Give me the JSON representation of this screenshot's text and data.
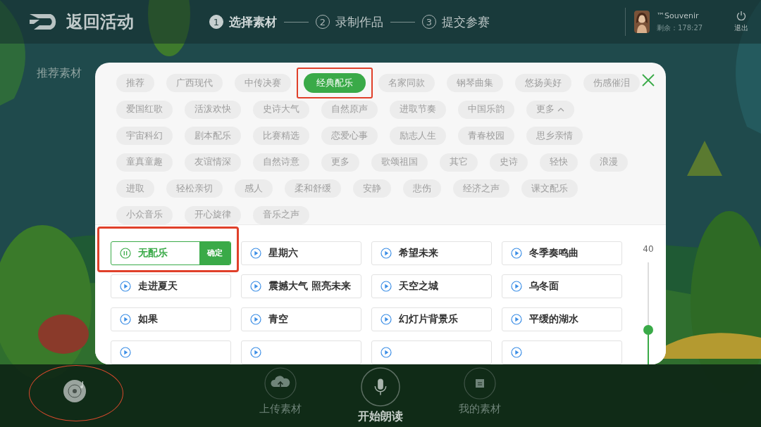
{
  "header": {
    "back_label": "返回活动",
    "steps": [
      {
        "number": "1",
        "label": "选择素材",
        "selected": true
      },
      {
        "number": "2",
        "label": "录制作品",
        "selected": false
      },
      {
        "number": "3",
        "label": "提交参赛",
        "selected": false
      }
    ],
    "user": {
      "name": "™Souvenir",
      "remaining": "剩余：178:27"
    },
    "logout": "退出"
  },
  "section_label": "推荐素材",
  "modal": {
    "tag_rows": [
      [
        {
          "label": "推荐",
          "selected": false
        },
        {
          "label": "广西现代",
          "selected": false
        },
        {
          "label": "中传决赛",
          "selected": false
        },
        {
          "label": "经典配乐",
          "selected": true
        },
        {
          "label": "名家同款",
          "selected": false
        },
        {
          "label": "钢琴曲集",
          "selected": false
        },
        {
          "label": "悠扬美好",
          "selected": false
        },
        {
          "label": "伤感催泪",
          "selected": false
        }
      ],
      [
        {
          "label": "爱国红歌",
          "selected": false
        },
        {
          "label": "活泼欢快",
          "selected": false
        },
        {
          "label": "史诗大气",
          "selected": false
        },
        {
          "label": "自然原声",
          "selected": false
        },
        {
          "label": "进取节奏",
          "selected": false
        },
        {
          "label": "中国乐韵",
          "selected": false
        },
        {
          "label": "更多",
          "selected": false,
          "kind": "more",
          "expanded": true
        }
      ],
      [
        {
          "label": "宇宙科幻",
          "selected": false
        },
        {
          "label": "剧本配乐",
          "selected": false
        },
        {
          "label": "比赛精选",
          "selected": false
        },
        {
          "label": "恋爱心事",
          "selected": false
        },
        {
          "label": "励志人生",
          "selected": false
        },
        {
          "label": "青春校园",
          "selected": false
        },
        {
          "label": "思乡亲情",
          "selected": false
        }
      ],
      [
        {
          "label": "童真童趣",
          "selected": false
        },
        {
          "label": "友谊情深",
          "selected": false
        },
        {
          "label": "自然诗意",
          "selected": false
        },
        {
          "label": "更多",
          "selected": false
        },
        {
          "label": "歌颂祖国",
          "selected": false
        },
        {
          "label": "其它",
          "selected": false
        },
        {
          "label": "史诗",
          "selected": false
        },
        {
          "label": "轻快",
          "selected": false
        },
        {
          "label": "浪漫",
          "selected": false
        }
      ],
      [
        {
          "label": "进取",
          "selected": false
        },
        {
          "label": "轻松亲切",
          "selected": false
        },
        {
          "label": "感人",
          "selected": false
        },
        {
          "label": "柔和舒缓",
          "selected": false
        },
        {
          "label": "安静",
          "selected": false
        },
        {
          "label": "悲伤",
          "selected": false
        },
        {
          "label": "经济之声",
          "selected": false
        },
        {
          "label": "课文配乐",
          "selected": false
        }
      ],
      [
        {
          "label": "小众音乐",
          "selected": false
        },
        {
          "label": "开心旋律",
          "selected": false
        },
        {
          "label": "音乐之声",
          "selected": false
        }
      ]
    ],
    "tracks": [
      {
        "title": "无配乐",
        "selected": true,
        "confirm": "确定"
      },
      {
        "title": "星期六",
        "selected": false
      },
      {
        "title": "希望未来",
        "selected": false
      },
      {
        "title": "冬季奏鸣曲",
        "selected": false
      },
      {
        "title": "走进夏天",
        "selected": false
      },
      {
        "title": "震撼大气 照亮未来",
        "selected": false
      },
      {
        "title": "天空之城",
        "selected": false
      },
      {
        "title": "乌冬面",
        "selected": false
      },
      {
        "title": "如果",
        "selected": false
      },
      {
        "title": "青空",
        "selected": false
      },
      {
        "title": "幻灯片背景乐",
        "selected": false
      },
      {
        "title": "平缓的湖水",
        "selected": false
      },
      {
        "kind": "clipped",
        "selected": false
      },
      {
        "kind": "clipped",
        "selected": false
      },
      {
        "kind": "clipped",
        "selected": false
      },
      {
        "kind": "clipped",
        "selected": false
      }
    ],
    "volume": {
      "reading": "40",
      "level": 0.4
    }
  },
  "bottom_nav": [
    {
      "kind": "disc",
      "selected": true
    },
    {
      "kind": "upload",
      "label": "上传素材",
      "selected": false
    },
    {
      "kind": "mic",
      "label": "开始朗读",
      "selected": false,
      "primary": true
    },
    {
      "kind": "folder",
      "label": "我的素材",
      "selected": false
    }
  ]
}
